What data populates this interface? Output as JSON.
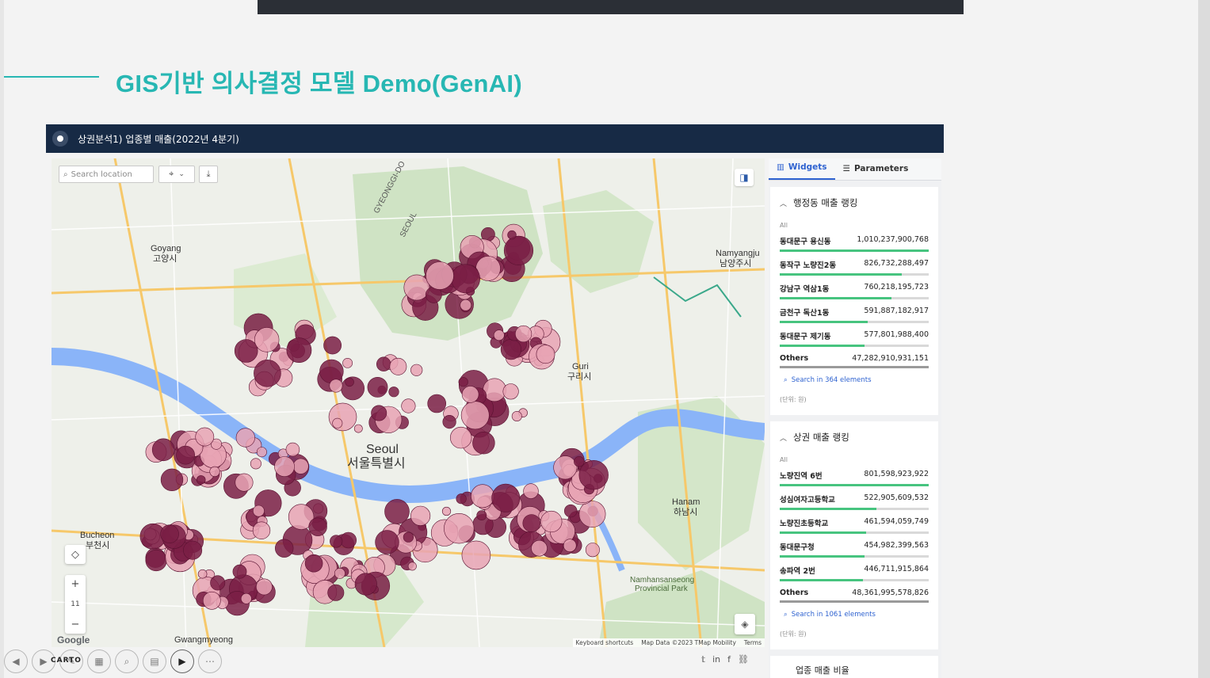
{
  "slide": {
    "title": "GIS기반 의사결정 모델 Demo(GenAI)"
  },
  "app": {
    "title": "상권분석1) 업종별 매출(2022년 4분기)"
  },
  "map": {
    "search_placeholder": "Search location",
    "zoom_level": "11",
    "google_label": "Google",
    "attribution": {
      "shortcuts": "Keyboard shortcuts",
      "data": "Map Data ©2023 TMap Mobility",
      "terms": "Terms"
    },
    "labels": [
      {
        "text": "Seoul",
        "kind": "city"
      },
      {
        "text": "서울특별시",
        "kind": "city"
      },
      {
        "text": "Goyang",
        "kind": "town"
      },
      {
        "text": "고양시",
        "kind": "town"
      },
      {
        "text": "Guri",
        "kind": "town"
      },
      {
        "text": "구리시",
        "kind": "town"
      },
      {
        "text": "Hanam",
        "kind": "town"
      },
      {
        "text": "하남시",
        "kind": "town"
      },
      {
        "text": "Bucheon",
        "kind": "town"
      },
      {
        "text": "부천시",
        "kind": "town"
      },
      {
        "text": "Gwangmyeong",
        "kind": "town"
      },
      {
        "text": "Namyangju",
        "kind": "town"
      },
      {
        "text": "남양주시",
        "kind": "town"
      },
      {
        "text": "Namhansanseong",
        "kind": "park"
      },
      {
        "text": "Provincial Park",
        "kind": "park"
      },
      {
        "text": "GYEONGGI-DO",
        "kind": "region"
      },
      {
        "text": "SEOUL",
        "kind": "region"
      }
    ]
  },
  "tabs": {
    "widgets": "Widgets",
    "parameters": "Parameters"
  },
  "widget1": {
    "title": "행정동 매출 랭킹",
    "filter": "All",
    "rows": [
      {
        "name": "동대문구 용신동",
        "value": "1,010,237,900,768",
        "fill": 1.0
      },
      {
        "name": "동작구 노량진2동",
        "value": "826,732,288,497",
        "fill": 0.82
      },
      {
        "name": "강남구 역삼1동",
        "value": "760,218,195,723",
        "fill": 0.75
      },
      {
        "name": "금천구 독산1동",
        "value": "591,887,182,917",
        "fill": 0.59
      },
      {
        "name": "동대문구 제기동",
        "value": "577,801,988,400",
        "fill": 0.57
      }
    ],
    "others": {
      "name": "Others",
      "value": "47,282,910,931,151",
      "fill": 1.0
    },
    "search": "Search in 364 elements",
    "unit": "(단위: 원)"
  },
  "widget2": {
    "title": "상권 매출 랭킹",
    "filter": "All",
    "rows": [
      {
        "name": "노량진역 6번",
        "value": "801,598,923,922",
        "fill": 1.0
      },
      {
        "name": "성심여자고등학교",
        "value": "522,905,609,532",
        "fill": 0.65
      },
      {
        "name": "노량진초등학교",
        "value": "461,594,059,749",
        "fill": 0.58
      },
      {
        "name": "동대문구청",
        "value": "454,982,399,563",
        "fill": 0.57
      },
      {
        "name": "송파역 2번",
        "value": "446,711,915,864",
        "fill": 0.56
      }
    ],
    "others": {
      "name": "Others",
      "value": "48,361,995,578,826",
      "fill": 1.0
    },
    "search": "Search in 1061 elements",
    "unit": "(단위: 원)"
  },
  "widget3": {
    "title": "업종 매출 비율"
  },
  "toolbar": {
    "carto": "CARTO"
  },
  "colors": {
    "accent": "#27b7b3",
    "header": "#172a45",
    "bubble_dark": "#7a1e45",
    "bubble_light": "#e8a3b4",
    "bar": "#47c47f",
    "tab_active": "#2e62d0"
  }
}
